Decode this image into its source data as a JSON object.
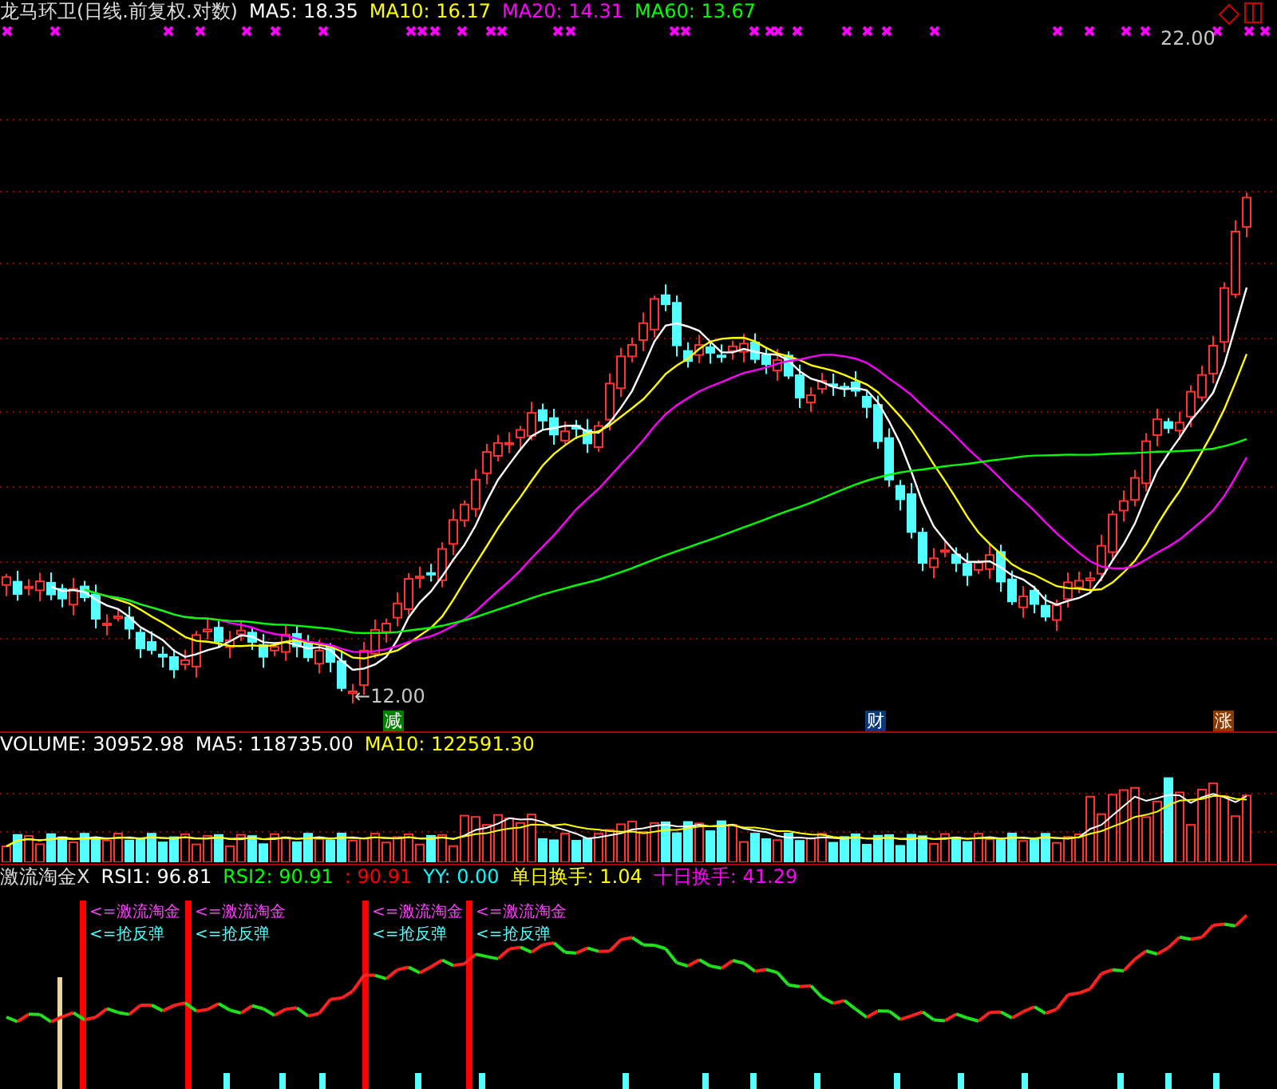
{
  "main": {
    "title": "龙马环卫(日线.前复权.对数)",
    "indicators": [
      {
        "label": "MA5: 18.35",
        "color": "#ffffff"
      },
      {
        "label": "MA10: 16.17",
        "color": "#ffff00"
      },
      {
        "label": "MA20: 14.31",
        "color": "#ff00ff"
      },
      {
        "label": "MA60: 13.67",
        "color": "#00ff00"
      }
    ],
    "high_label": "22.00",
    "low_label": "12.00",
    "low_arrow": "←",
    "event_badges": [
      {
        "text": "减",
        "color": "#008000"
      },
      {
        "text": "财",
        "color": "#0a3a78"
      },
      {
        "text": "涨",
        "color": "#8b3a00"
      }
    ]
  },
  "volume": {
    "indicators": [
      {
        "label": "VOLUME: 30952.98",
        "color": "#ffffff"
      },
      {
        "label": "MA5: 118735.00",
        "color": "#ffffff"
      },
      {
        "label": "MA10: 122591.30",
        "color": "#ffff00"
      }
    ]
  },
  "oscillator": {
    "title": "激流淘金X",
    "indicators": [
      {
        "label": "RSI1: 96.81",
        "color": "#ffffff"
      },
      {
        "label": "RSI2: 90.91",
        "color": "#00ff00"
      },
      {
        "label": ": 90.91",
        "color": "#ff0000"
      },
      {
        "label": "YY: 0.00",
        "color": "#00ffff"
      },
      {
        "label": "单日换手: 1.04",
        "color": "#ffff00"
      },
      {
        "label": "十日换手: 41.29",
        "color": "#ff00ff"
      }
    ],
    "signals": [
      {
        "primary": "<=激流淘金",
        "secondary": "<=抢反弹"
      },
      {
        "primary": "<=激流淘金",
        "secondary": "<=抢反弹"
      },
      {
        "primary": "<=激流淘金",
        "secondary": "<=抢反弹"
      },
      {
        "primary": "<=激流淘金",
        "secondary": "<=抢反弹"
      }
    ]
  }
}
